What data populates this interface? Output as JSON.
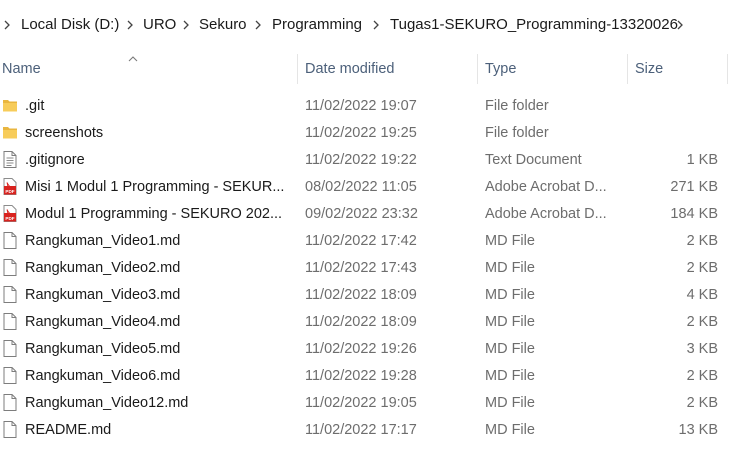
{
  "breadcrumb": {
    "items": [
      "Local Disk (D:)",
      "URO",
      "Sekuro",
      "Programming",
      "Tugas1-SEKURO_Programming-13320026"
    ]
  },
  "columns": {
    "name": "Name",
    "date_modified": "Date modified",
    "type": "Type",
    "size": "Size"
  },
  "files": [
    {
      "icon": "folder-icon",
      "name": ".git",
      "date": "11/02/2022 19:07",
      "type": "File folder",
      "size": ""
    },
    {
      "icon": "folder-icon",
      "name": "screenshots",
      "date": "11/02/2022 19:25",
      "type": "File folder",
      "size": ""
    },
    {
      "icon": "text-document-icon",
      "name": ".gitignore",
      "date": "11/02/2022 19:22",
      "type": "Text Document",
      "size": "1 KB"
    },
    {
      "icon": "pdf-icon",
      "name": "Misi 1 Modul 1 Programming - SEKUR...",
      "date": "08/02/2022 11:05",
      "type": "Adobe Acrobat D...",
      "size": "271 KB"
    },
    {
      "icon": "pdf-icon",
      "name": "Modul 1 Programming - SEKURO 202...",
      "date": "09/02/2022 23:32",
      "type": "Adobe Acrobat D...",
      "size": "184 KB"
    },
    {
      "icon": "file-icon",
      "name": "Rangkuman_Video1.md",
      "date": "11/02/2022 17:42",
      "type": "MD File",
      "size": "2 KB"
    },
    {
      "icon": "file-icon",
      "name": "Rangkuman_Video2.md",
      "date": "11/02/2022 17:43",
      "type": "MD File",
      "size": "2 KB"
    },
    {
      "icon": "file-icon",
      "name": "Rangkuman_Video3.md",
      "date": "11/02/2022 18:09",
      "type": "MD File",
      "size": "4 KB"
    },
    {
      "icon": "file-icon",
      "name": "Rangkuman_Video4.md",
      "date": "11/02/2022 18:09",
      "type": "MD File",
      "size": "2 KB"
    },
    {
      "icon": "file-icon",
      "name": "Rangkuman_Video5.md",
      "date": "11/02/2022 19:26",
      "type": "MD File",
      "size": "3 KB"
    },
    {
      "icon": "file-icon",
      "name": "Rangkuman_Video6.md",
      "date": "11/02/2022 19:28",
      "type": "MD File",
      "size": "2 KB"
    },
    {
      "icon": "file-icon",
      "name": "Rangkuman_Video12.md",
      "date": "11/02/2022 19:05",
      "type": "MD File",
      "size": "2 KB"
    },
    {
      "icon": "file-icon",
      "name": "README.md",
      "date": "11/02/2022 17:17",
      "type": "MD File",
      "size": "13 KB"
    }
  ]
}
